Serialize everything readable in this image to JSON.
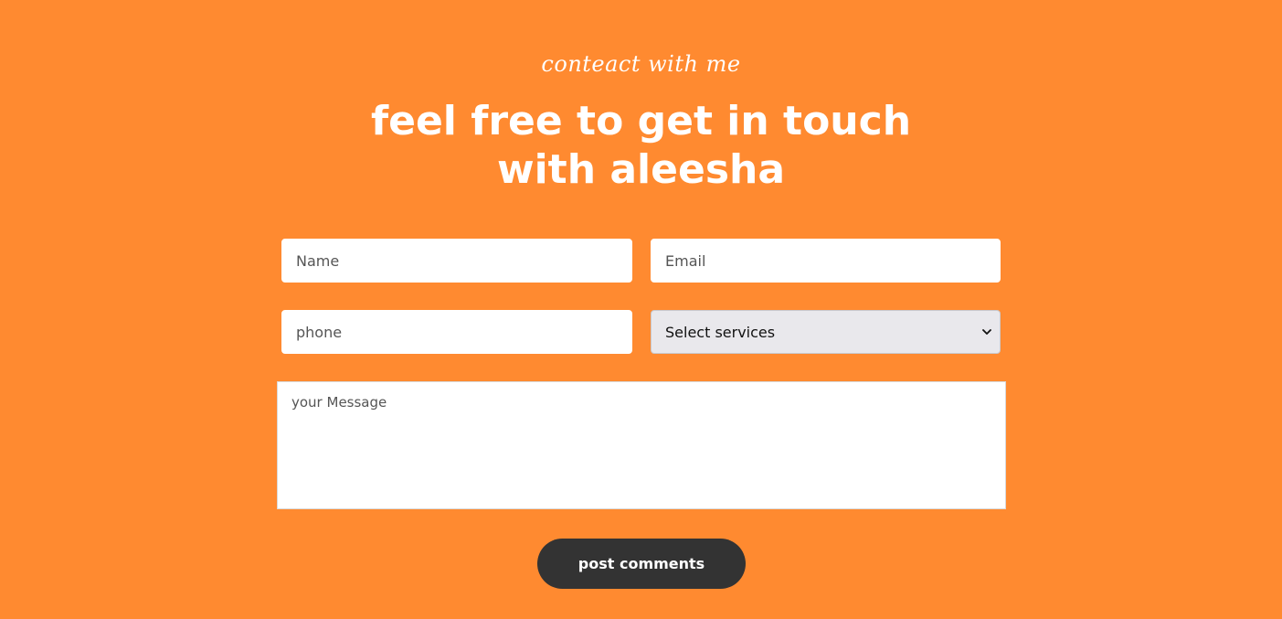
{
  "header": {
    "eyebrow": "conteact with me",
    "title_line1": "feel free to get in touch",
    "title_line2": "with aleesha"
  },
  "form": {
    "name_placeholder": "Name",
    "email_placeholder": "Email",
    "phone_placeholder": "phone",
    "services_selected": "Select services",
    "message_placeholder": "your Message",
    "submit_label": "post comments"
  },
  "icons": {
    "select_arrow": "chevron-down-icon"
  },
  "colors": {
    "background": "#ff8a30",
    "button": "#333333",
    "text_light": "#ffffff"
  }
}
